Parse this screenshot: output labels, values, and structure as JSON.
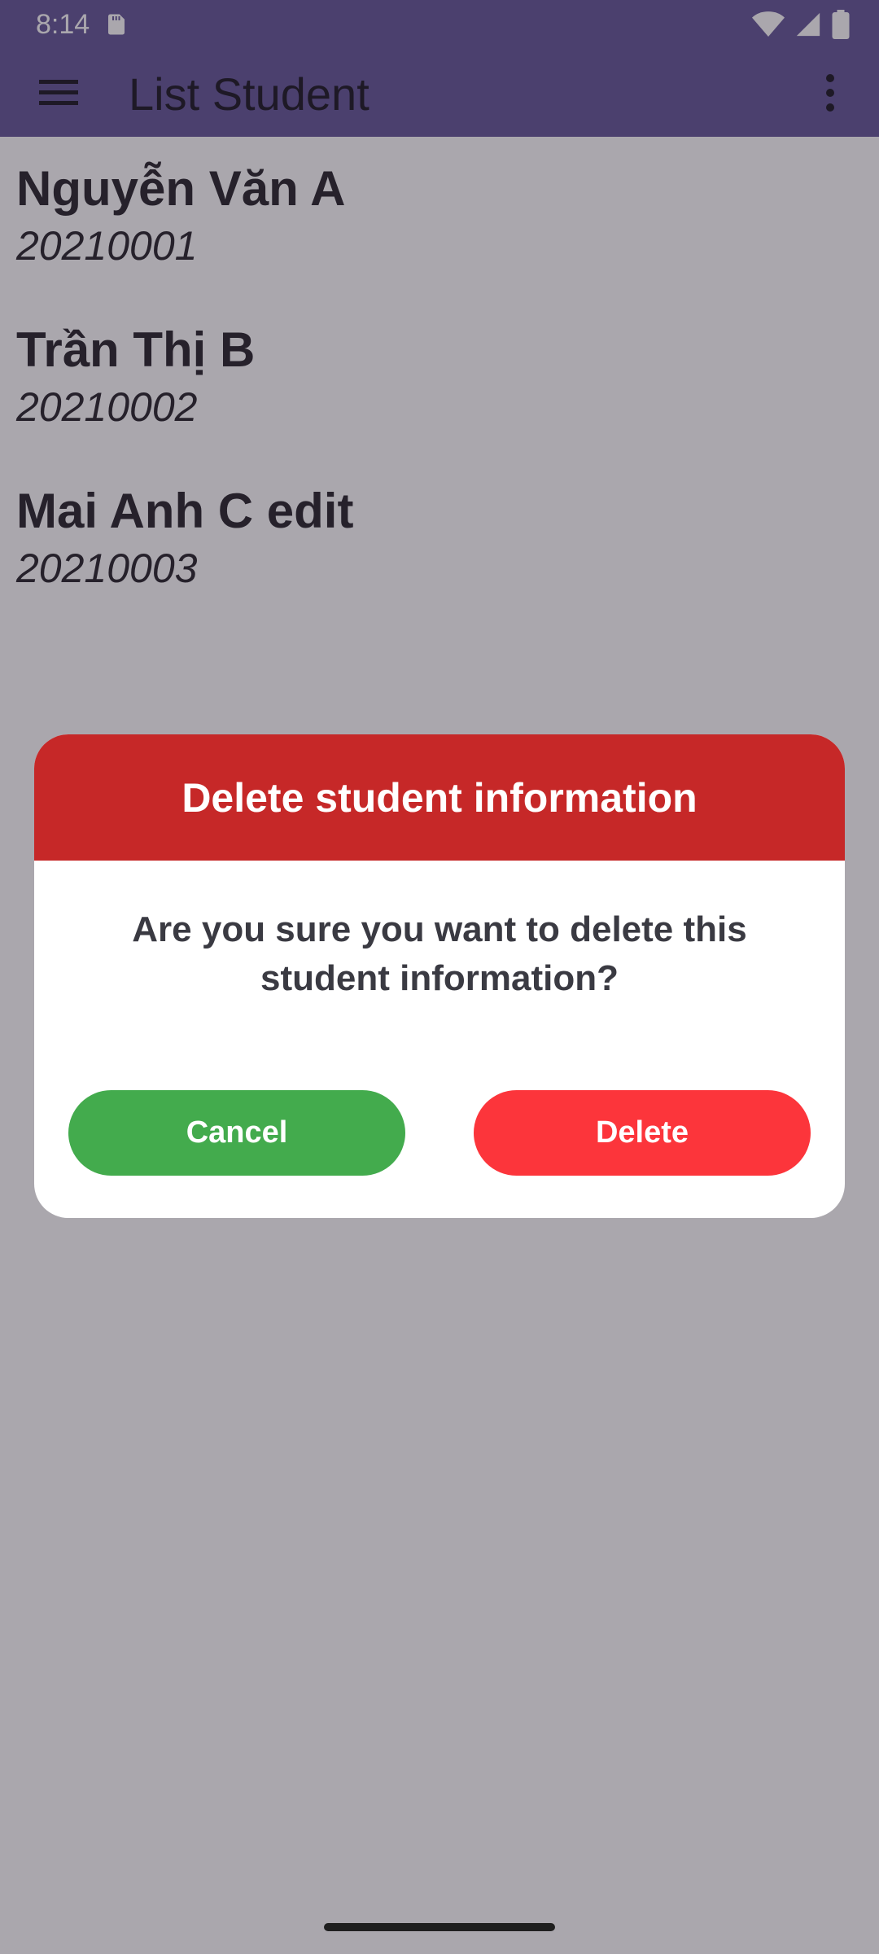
{
  "status_bar": {
    "time": "8:14",
    "icons": [
      "sd-card-icon",
      "wifi-icon",
      "signal-icon",
      "battery-icon"
    ]
  },
  "app_bar": {
    "title": "List Student",
    "menu_icon": "hamburger-menu-icon",
    "overflow_icon": "more-vert-icon"
  },
  "students": [
    {
      "name": "Nguyễn Văn A",
      "id": "20210001"
    },
    {
      "name": "Trần Thị B",
      "id": "20210002"
    },
    {
      "name": "Mai Anh C edit",
      "id": "20210003"
    }
  ],
  "dialog": {
    "title": "Delete student information",
    "message": "Are you sure you want to delete this student information?",
    "cancel_label": "Cancel",
    "delete_label": "Delete"
  },
  "colors": {
    "app_bar": "#675a9a",
    "dialog_header": "#c62828",
    "cancel_button": "#43ab4d",
    "delete_button": "#fc353b"
  }
}
